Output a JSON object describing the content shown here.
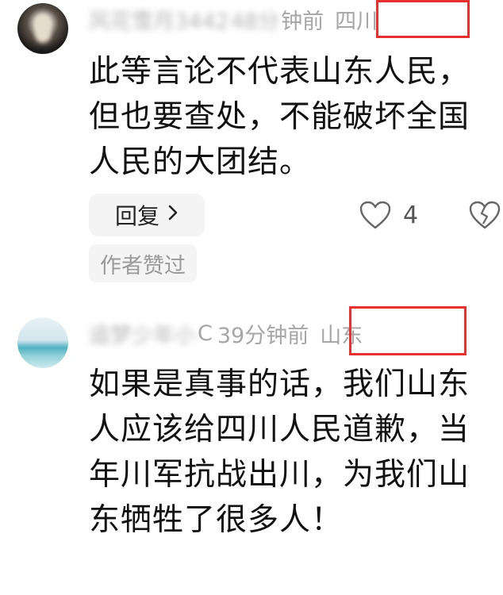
{
  "comments": [
    {
      "nickname_blurred": "风花雪月3442",
      "nickname_suffix": "",
      "time_blurred": "48分",
      "time_visible": "钟前",
      "location": "四川",
      "body": "此等言论不代表山东人民，但也要查处，不能破坏全国人民的大团结。",
      "reply_label": "回复",
      "like_count": "4",
      "author_liked_label": "作者赞过",
      "icons": {
        "reply_chevron": "chevron-right-icon",
        "like": "heart-icon",
        "dislike": "broken-heart-icon"
      }
    },
    {
      "nickname_blurred": "追梦少年小",
      "nickname_suffix": "C",
      "time_visible": "39分钟前",
      "location": "山东",
      "body": "如果是真事的话，我们山东人应该给四川人民道歉，当年川军抗战出川，为我们山东牺牲了很多人！"
    }
  ],
  "highlight_color": "#e8302f"
}
